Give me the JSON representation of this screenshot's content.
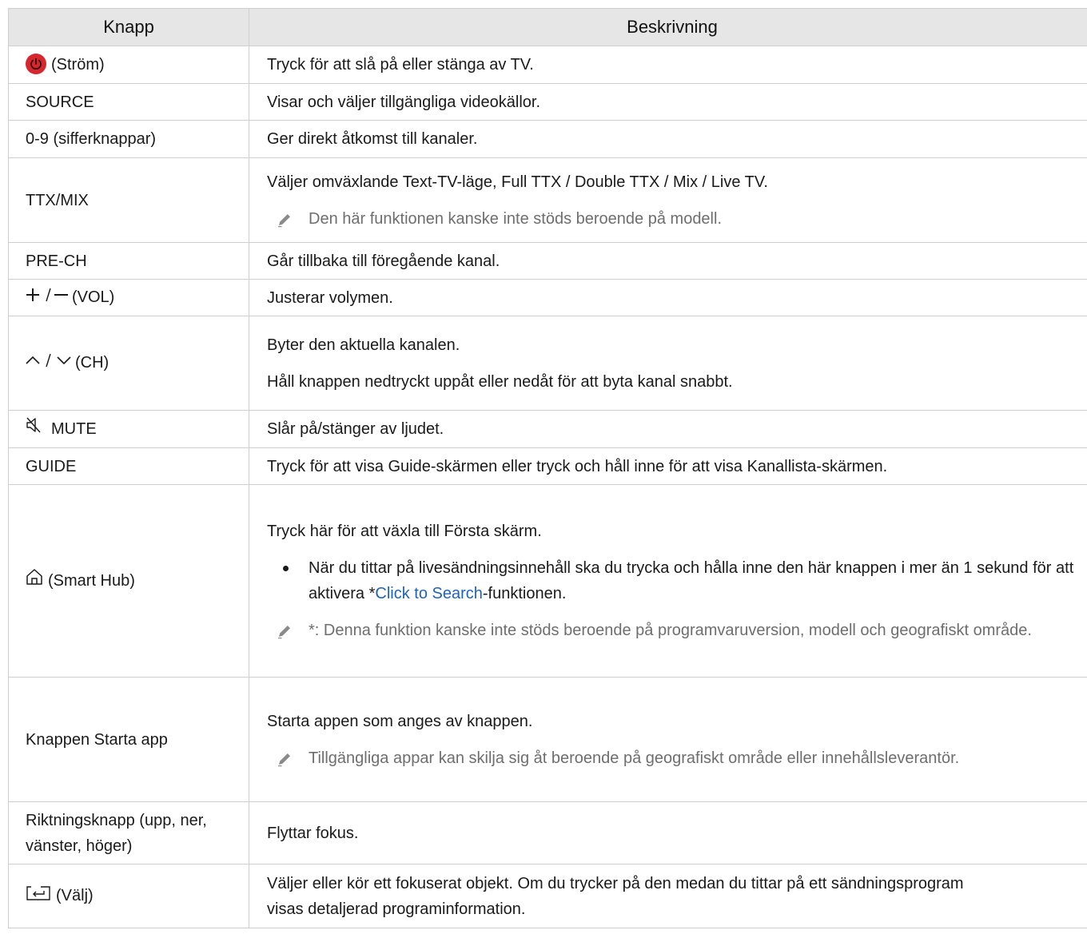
{
  "header": {
    "col1": "Knapp",
    "col2": "Beskrivning"
  },
  "rows": {
    "power": {
      "icon": "power-icon",
      "label": "(Ström)",
      "desc": "Tryck för att slå på eller stänga av TV."
    },
    "source": {
      "label": "SOURCE",
      "desc": "Visar och väljer tillgängliga videokällor."
    },
    "digits": {
      "label": "0-9 (sifferknappar)",
      "desc": "Ger direkt åtkomst till kanaler."
    },
    "ttx": {
      "label": "TTX/MIX",
      "desc": "Väljer omväxlande Text-TV-läge, Full TTX / Double TTX / Mix / Live TV.",
      "note": "Den här funktionen kanske inte stöds beroende på modell."
    },
    "prech": {
      "label": "PRE-CH",
      "desc": "Går tillbaka till föregående kanal."
    },
    "vol": {
      "icon": "plus-minus-icon",
      "label": "(VOL)",
      "desc": "Justerar volymen."
    },
    "ch": {
      "icon": "chevron-up-down-icon",
      "label": "(CH)",
      "desc1": "Byter den aktuella kanalen.",
      "desc2": "Håll knappen nedtryckt uppåt eller nedåt för att byta kanal snabbt."
    },
    "mute": {
      "icon": "mute-icon",
      "label": "MUTE",
      "desc": "Slår på/stänger av ljudet."
    },
    "guide": {
      "label": "GUIDE",
      "desc": "Tryck för att visa Guide-skärmen eller tryck och håll inne för att visa Kanallista-skärmen."
    },
    "smarthub": {
      "icon": "home-icon",
      "label": "(Smart Hub)",
      "desc": "Tryck här för att växla till Första skärm.",
      "bullet_before": "När du tittar på livesändningsinnehåll ska du trycka och hålla inne den här knappen i mer än 1 sekund för att aktivera *",
      "bullet_link": "Click to Search",
      "bullet_after": "-funktionen.",
      "note": "*: Denna funktion kanske inte stöds beroende på programvaruversion, modell och geografiskt område."
    },
    "startapp": {
      "label": "Knappen Starta app",
      "desc": "Starta appen som anges av knappen.",
      "note": "Tillgängliga appar kan skilja sig åt beroende på geografiskt område eller innehållsleverantör."
    },
    "direction": {
      "label": "Riktningsknapp (upp, ner, vänster, höger)",
      "desc": "Flyttar fokus."
    },
    "select": {
      "icon": "select-enter-icon",
      "label": "(Välj)",
      "desc": "Väljer eller kör ett fokuserat objekt. Om du trycker på den medan du tittar på ett sändningsprogram visas detaljerad programinformation."
    }
  },
  "colors": {
    "header_bg": "#e6e6e6",
    "border": "#cfcfcf",
    "note_text": "#6e6e6e",
    "link": "#1f63b8",
    "power_red": "#d8262e"
  }
}
